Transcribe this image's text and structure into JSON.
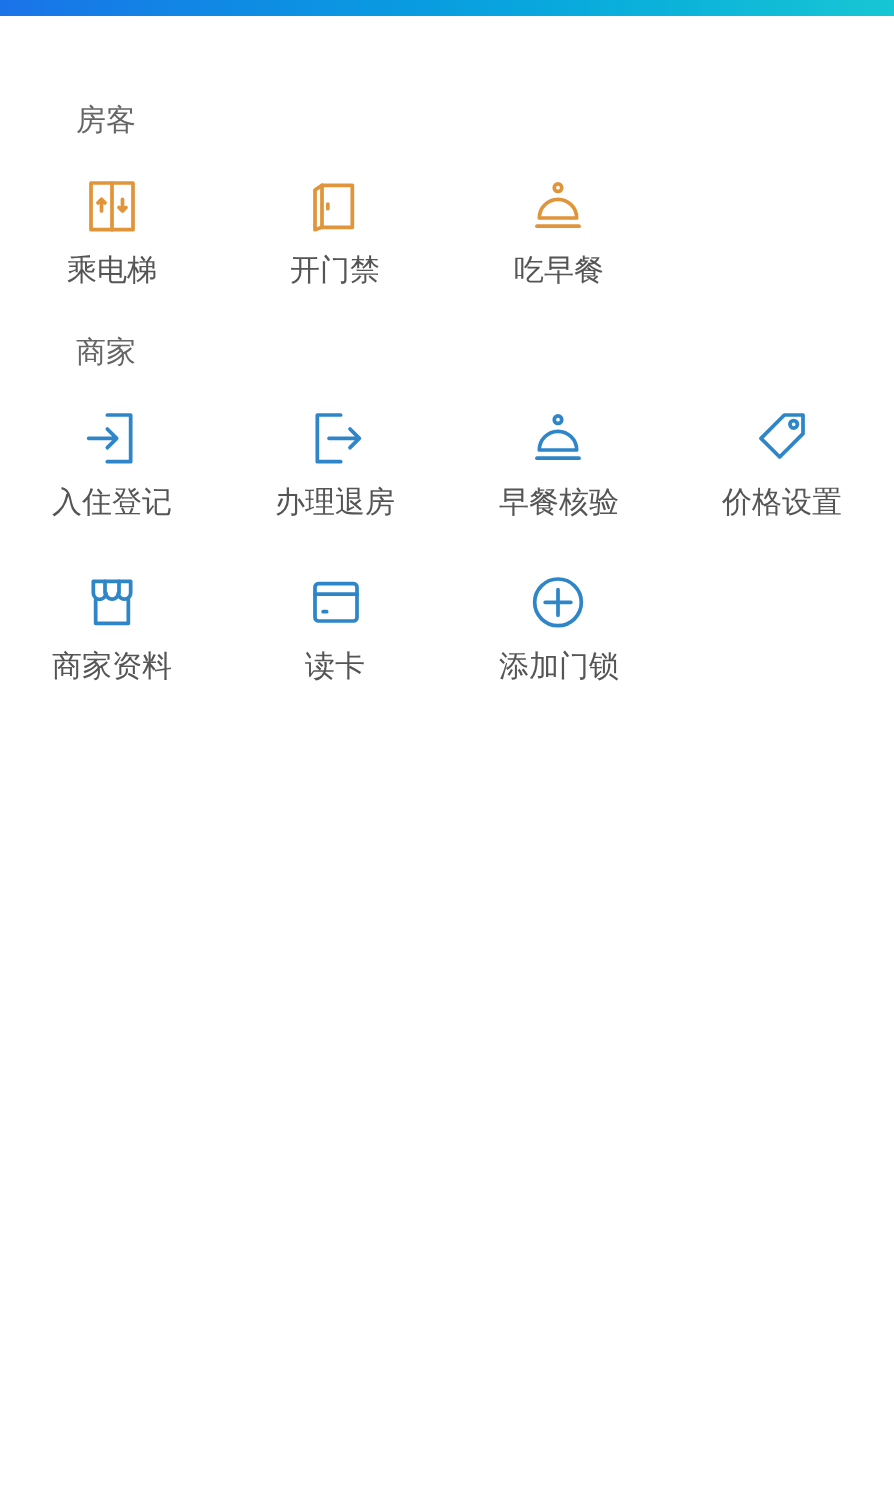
{
  "sections": [
    {
      "title": "房客",
      "color": "#e0953a",
      "items": [
        {
          "label": "乘电梯"
        },
        {
          "label": "开门禁"
        },
        {
          "label": "吃早餐"
        }
      ]
    },
    {
      "title": "商家",
      "color": "#2e86c8",
      "items": [
        {
          "label": "入住登记"
        },
        {
          "label": "办理退房"
        },
        {
          "label": "早餐核验"
        },
        {
          "label": "价格设置"
        },
        {
          "label": "商家资料"
        },
        {
          "label": "读卡"
        },
        {
          "label": "添加门锁"
        }
      ]
    }
  ]
}
